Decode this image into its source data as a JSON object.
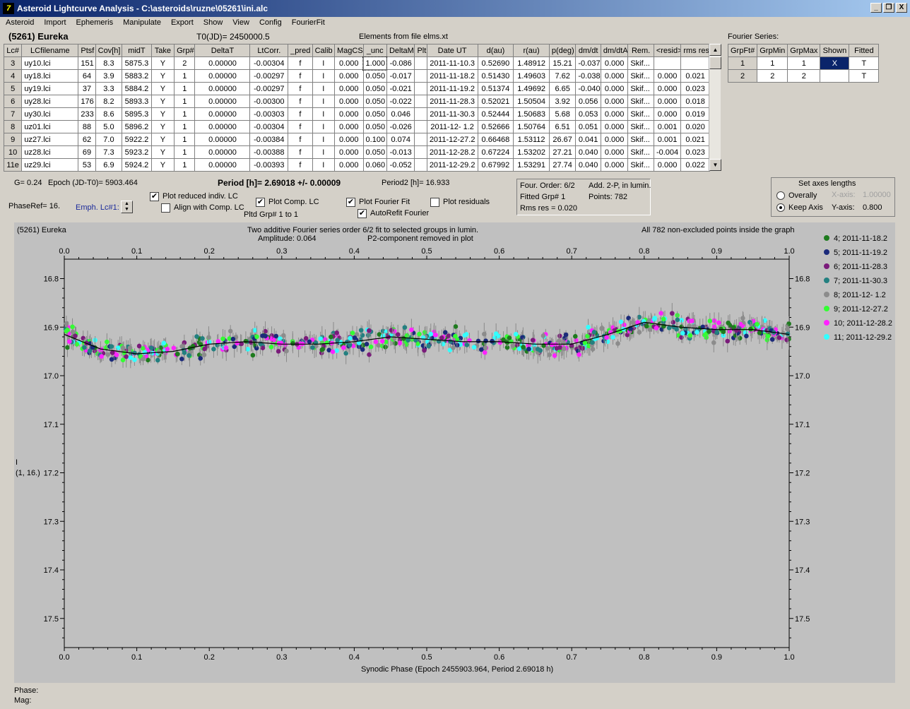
{
  "window": {
    "title": "Asteroid Lightcurve Analysis - C:\\asteroids\\ruzne\\05261\\ini.alc",
    "minimize": "_",
    "restore": "❐",
    "close": "X"
  },
  "menu": [
    "Asteroid",
    "Import",
    "Ephemeris",
    "Manipulate",
    "Export",
    "Show",
    "View",
    "Config",
    "FourierFit"
  ],
  "header": {
    "asteroid": "(5261) Eureka",
    "t0": "T0(JD)= 2450000.5",
    "elements": "Elements from file elms.xt",
    "fourier_title": "Fourier Series:"
  },
  "lc_table": {
    "columns": [
      "Lc#",
      "LCfilename",
      "Ptsf",
      "Cov[h]",
      "midT",
      "Take",
      "Grp#",
      "DeltaT",
      "LtCorr.",
      "_pred",
      "Calib",
      "MagCS",
      "_unc",
      "DeltaM",
      "Plt",
      "Date UT",
      "d(au)",
      "r(au)",
      "p(deg)",
      "dm/dt",
      "dm/dtA",
      "Rem.",
      "<resid>",
      "rms res"
    ],
    "rows": [
      [
        "3",
        "uy10.lci",
        "151",
        "8.3",
        "5875.3",
        "Y",
        "2",
        "0.00000",
        "-0.00304",
        "f",
        "I",
        "0.000",
        "1.000",
        "-0.086",
        "",
        "2011-11-10.3",
        "0.52690",
        "1.48912",
        "15.21",
        "-0.037",
        "0.000",
        "Skif...",
        "",
        ""
      ],
      [
        "4",
        "uy18.lci",
        "64",
        "3.9",
        "5883.2",
        "Y",
        "1",
        "0.00000",
        "-0.00297",
        "f",
        "I",
        "0.000",
        "0.050",
        "-0.017",
        "",
        "2011-11-18.2",
        "0.51430",
        "1.49603",
        "7.62",
        "-0.038",
        "0.000",
        "Skif...",
        "0.000",
        "0.021"
      ],
      [
        "5",
        "uy19.lci",
        "37",
        "3.3",
        "5884.2",
        "Y",
        "1",
        "0.00000",
        "-0.00297",
        "f",
        "I",
        "0.000",
        "0.050",
        "-0.021",
        "",
        "2011-11-19.2",
        "0.51374",
        "1.49692",
        "6.65",
        "-0.040",
        "0.000",
        "Skif...",
        "0.000",
        "0.023"
      ],
      [
        "6",
        "uy28.lci",
        "176",
        "8.2",
        "5893.3",
        "Y",
        "1",
        "0.00000",
        "-0.00300",
        "f",
        "I",
        "0.000",
        "0.050",
        "-0.022",
        "",
        "2011-11-28.3",
        "0.52021",
        "1.50504",
        "3.92",
        "0.056",
        "0.000",
        "Skif...",
        "0.000",
        "0.018"
      ],
      [
        "7",
        "uy30.lci",
        "233",
        "8.6",
        "5895.3",
        "Y",
        "1",
        "0.00000",
        "-0.00303",
        "f",
        "I",
        "0.000",
        "0.050",
        "0.046",
        "",
        "2011-11-30.3",
        "0.52444",
        "1.50683",
        "5.68",
        "0.053",
        "0.000",
        "Skif...",
        "0.000",
        "0.019"
      ],
      [
        "8",
        "uz01.lci",
        "88",
        "5.0",
        "5896.2",
        "Y",
        "1",
        "0.00000",
        "-0.00304",
        "f",
        "I",
        "0.000",
        "0.050",
        "-0.026",
        "",
        "2011-12- 1.2",
        "0.52666",
        "1.50764",
        "6.51",
        "0.051",
        "0.000",
        "Skif...",
        "0.001",
        "0.020"
      ],
      [
        "9",
        "uz27.lci",
        "62",
        "7.0",
        "5922.2",
        "Y",
        "1",
        "0.00000",
        "-0.00384",
        "f",
        "I",
        "0.000",
        "0.100",
        "0.074",
        "",
        "2011-12-27.2",
        "0.66468",
        "1.53112",
        "26.67",
        "0.041",
        "0.000",
        "Skif...",
        "0.001",
        "0.021"
      ],
      [
        "10",
        "uz28.lci",
        "69",
        "7.3",
        "5923.2",
        "Y",
        "1",
        "0.00000",
        "-0.00388",
        "f",
        "I",
        "0.000",
        "0.050",
        "-0.013",
        "",
        "2011-12-28.2",
        "0.67224",
        "1.53202",
        "27.21",
        "0.040",
        "0.000",
        "Skif...",
        "-0.004",
        "0.023"
      ],
      [
        "11e",
        "uz29.lci",
        "53",
        "6.9",
        "5924.2",
        "Y",
        "1",
        "0.00000",
        "-0.00393",
        "f",
        "I",
        "0.000",
        "0.060",
        "-0.052",
        "",
        "2011-12-29.2",
        "0.67992",
        "1.53291",
        "27.74",
        "0.040",
        "0.000",
        "Skif...",
        "0.000",
        "0.022"
      ]
    ]
  },
  "fourier_table": {
    "columns": [
      "GrpFt#",
      "GrpMin",
      "GrpMax",
      "Shown",
      "Fitted"
    ],
    "rows": [
      [
        "1",
        "1",
        "1",
        "X",
        "T"
      ],
      [
        "2",
        "2",
        "2",
        "",
        "T"
      ]
    ]
  },
  "controls": {
    "g": "G= 0.24",
    "epoch": "Epoch (JD-T0)= 5903.464",
    "period": "Period [h]= 2.69018 +/- 0.00009",
    "period2": "Period2 [h]= 16.933",
    "phaseref": "PhaseRef= 16.",
    "emph": "Emph. Lc#1:",
    "plot_reduced": "Plot reduced indiv. LC",
    "align_comp": "Align with Comp. LC",
    "plot_comp": "Plot Comp. LC",
    "plotted_grp": "Pltd Grp#  1   to   1",
    "plot_fourier": "Plot Fourier Fit",
    "autorefit": "AutoRefit Fourier",
    "plot_residuals": "Plot residuals",
    "four_order": "Four. Order:  6/2",
    "add": "Add. 2-P,  in lumin.",
    "fitted_grp": "Fitted Grp# 1",
    "points": "Points: 782",
    "rms": "Rms res     = 0.020",
    "axes_title": "Set axes lengths",
    "overally": "Overally",
    "keep_axis": "Keep Axis",
    "xaxis_label": "X-axis:",
    "xaxis_val": "1.00000",
    "yaxis_label": "Y-axis:",
    "yaxis_val": "0.800"
  },
  "status": {
    "phase": "Phase:",
    "mag": "Mag:"
  },
  "chart_data": {
    "type": "scatter",
    "title": "(5261) Eureka",
    "subtitle1": "Two additive Fourier series order 6/2 fit to selected groups in lumin.",
    "subtitle2": "Amplitude: 0.064",
    "subtitle3": "P2-component removed in plot",
    "note": "All 782 non-excluded points inside the graph",
    "xlabel": "Synodic Phase (Epoch 2455903.964, Period 2.69018 h)",
    "ylabel": "I",
    "ylabel2": "(1, 16.)",
    "xlim": [
      0.0,
      1.0
    ],
    "ylim": [
      17.56,
      16.76
    ],
    "x_ticks": [
      "0.0",
      "0.1",
      "0.2",
      "0.3",
      "0.4",
      "0.5",
      "0.6",
      "0.7",
      "0.8",
      "0.9",
      "1.0"
    ],
    "y_ticks": [
      "16.8",
      "16.9",
      "17.0",
      "17.1",
      "17.2",
      "17.3",
      "17.4",
      "17.5"
    ],
    "fit_curve": {
      "x": [
        0.0,
        0.05,
        0.1,
        0.15,
        0.2,
        0.25,
        0.3,
        0.35,
        0.4,
        0.45,
        0.5,
        0.55,
        0.6,
        0.65,
        0.7,
        0.75,
        0.8,
        0.85,
        0.9,
        0.95,
        1.0
      ],
      "y": [
        16.915,
        16.945,
        16.955,
        16.95,
        16.935,
        16.93,
        16.935,
        16.935,
        16.93,
        16.92,
        16.925,
        16.93,
        16.93,
        16.935,
        16.935,
        16.915,
        16.89,
        16.9,
        16.905,
        16.905,
        16.915
      ]
    },
    "series": [
      {
        "name": "4; 2011-11-18.2",
        "color": "#1e7b1e"
      },
      {
        "name": "5; 2011-11-19.2",
        "color": "#1b2a7a"
      },
      {
        "name": "6; 2011-11-28.3",
        "color": "#7a1b7a"
      },
      {
        "name": "7; 2011-11-30.3",
        "color": "#238080"
      },
      {
        "name": "8; 2011-12- 1.2",
        "color": "#8c8c8c"
      },
      {
        "name": "9; 2011-12-27.2",
        "color": "#33ff33"
      },
      {
        "name": "10; 2011-12-28.2",
        "color": "#ff22ff"
      },
      {
        "name": "11; 2011-12-29.2",
        "color": "#33ffff"
      }
    ]
  }
}
